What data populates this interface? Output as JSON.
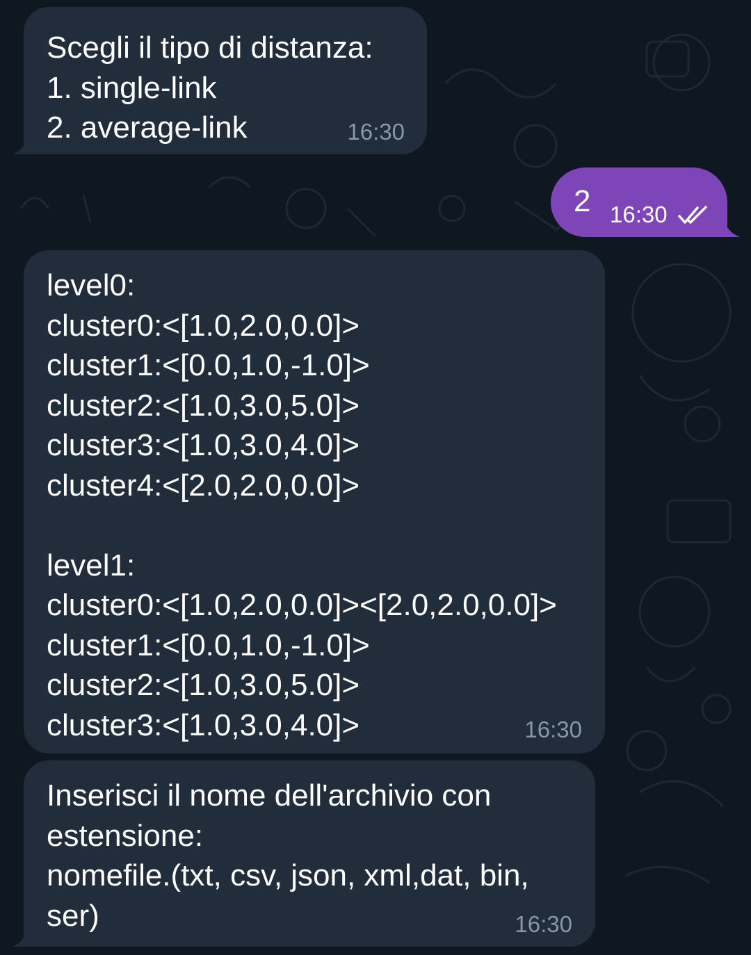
{
  "chat": {
    "messages": [
      {
        "direction": "incoming",
        "lines": [
          "Scegli il tipo di distanza:",
          "1. single-link",
          "2. average-link"
        ],
        "time": "16:30"
      },
      {
        "direction": "outgoing",
        "text": "2",
        "time": "16:30",
        "status_icon": "double-check-icon"
      },
      {
        "direction": "incoming",
        "lines_level0": [
          "level0:",
          "cluster0:<[1.0,2.0,0.0]>",
          "cluster1:<[0.0,1.0,-1.0]>",
          "cluster2:<[1.0,3.0,5.0]>",
          "cluster3:<[1.0,3.0,4.0]>",
          "cluster4:<[2.0,2.0,0.0]>"
        ],
        "lines_level1": [
          "level1:",
          "cluster0:<[1.0,2.0,0.0]><[2.0,2.0,0.0]>",
          "cluster1:<[0.0,1.0,-1.0]>",
          "cluster2:<[1.0,3.0,5.0]>",
          "cluster3:<[1.0,3.0,4.0]>"
        ],
        "time": "16:30"
      },
      {
        "direction": "incoming",
        "lines": [
          "Inserisci il nome dell'archivio con",
          "estensione:",
          "nomefile.(txt, csv, json, xml,dat, bin,",
          "ser)"
        ],
        "time": "16:30"
      }
    ]
  },
  "colors": {
    "background": "#0f1720",
    "incoming_bubble": "#212d3b",
    "outgoing_bubble": "#7e45b8",
    "time_incoming": "#8897a8"
  }
}
